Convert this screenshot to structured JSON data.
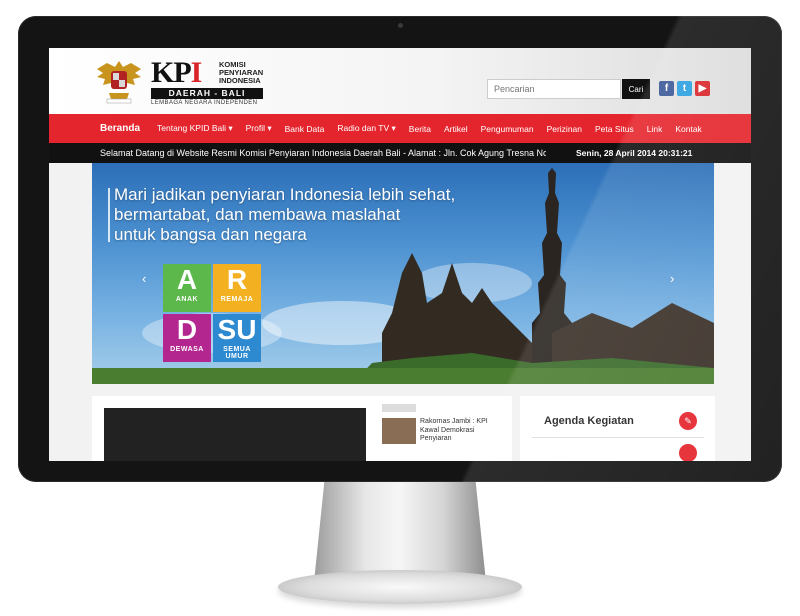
{
  "header": {
    "kpi_letters": "KP",
    "kpi_i": "I",
    "kpi_small_line1": "KOMISI",
    "kpi_small_line2": "PENYIARAN",
    "kpi_small_line3": "INDONESIA",
    "region": "DAERAH - BALI",
    "tagline": "LEMBAGA NEGARA INDEPENDEN",
    "search_placeholder": "Pencarian",
    "search_button": "Cari",
    "social": {
      "facebook": "f",
      "twitter": "t",
      "youtube": "▶"
    }
  },
  "nav": {
    "items": [
      "Beranda",
      "Tentang KPID Bali ▾",
      "Profil ▾",
      "Bank Data",
      "Radio dan TV ▾",
      "Berita",
      "Artikel",
      "Pengumuman",
      "Perizinan",
      "Peta Situs",
      "Link",
      "Kontak"
    ]
  },
  "ticker": {
    "text": "Selamat Datang di Website Resmi Komisi Penyiaran Indonesia Daerah Bali - Alamat : Jln. Cok Agung Tresna No.",
    "datetime": "Senin, 28 April 2014 20:31:21"
  },
  "banner": {
    "headline_line1": "Mari jadikan penyiaran Indonesia lebih sehat,",
    "headline_line2": "bermartabat, dan membawa maslahat",
    "headline_line3": "untuk bangsa dan negara",
    "arrow_left": "‹",
    "arrow_right": "›",
    "rating": {
      "a_letter": "A",
      "a_caption": "ANAK",
      "r_letter": "R",
      "r_caption": "REMAJA",
      "d_letter": "D",
      "d_caption": "DEWASA",
      "su_letter": "SU",
      "su_caption": "SEMUA UMUR"
    }
  },
  "news": {
    "item1_title": "Rakornas Jambi : KPI Kawal Demokrasi Penyiaran"
  },
  "agenda": {
    "title": "Agenda Kegiatan",
    "icon": "✎"
  },
  "colors": {
    "brand_red": "#e5252d",
    "ticker_bg": "#111111"
  }
}
